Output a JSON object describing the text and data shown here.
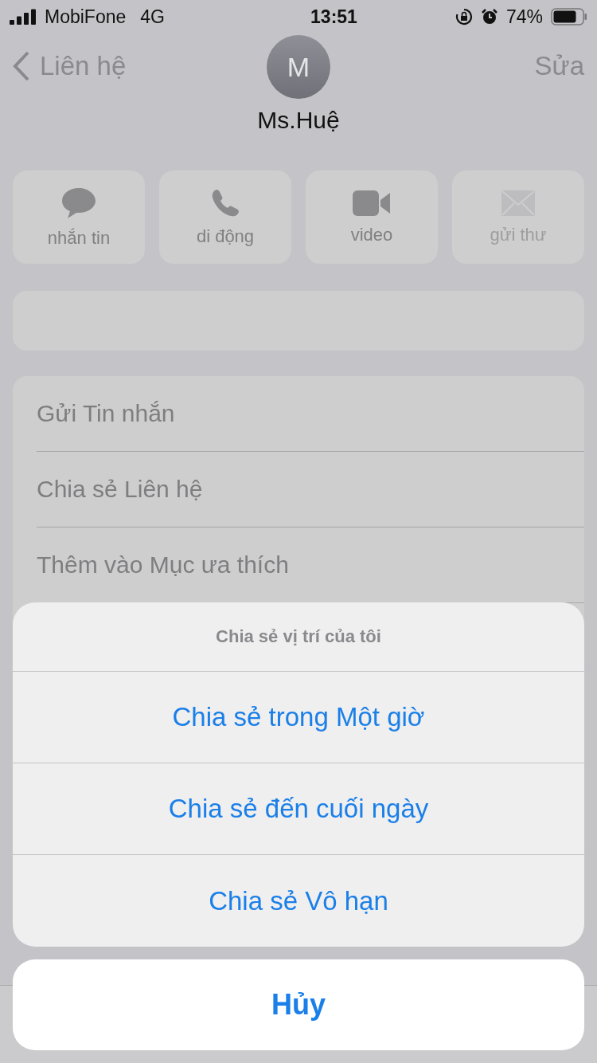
{
  "status_bar": {
    "carrier": "MobiFone",
    "network": "4G",
    "time": "13:51",
    "battery": "74%"
  },
  "nav": {
    "back": "Liên hệ",
    "edit": "Sửa"
  },
  "contact": {
    "initial": "M",
    "name": "Ms.Huệ"
  },
  "actions": [
    {
      "kind": "message",
      "label": "nhắn tin",
      "disabled": false
    },
    {
      "kind": "phone",
      "label": "di động",
      "disabled": false
    },
    {
      "kind": "video",
      "label": "video",
      "disabled": false
    },
    {
      "kind": "mail",
      "label": "gửi thư",
      "disabled": true
    }
  ],
  "menu": [
    "Gửi Tin nhắn",
    "Chia sẻ Liên hệ",
    "Thêm vào Mục ưa thích"
  ],
  "action_sheet": {
    "title": "Chia sẻ vị trí của tôi",
    "options": [
      "Chia sẻ trong Một giờ",
      "Chia sẻ đến cuối ngày",
      "Chia sẻ Vô hạn"
    ],
    "cancel": "Hủy"
  }
}
